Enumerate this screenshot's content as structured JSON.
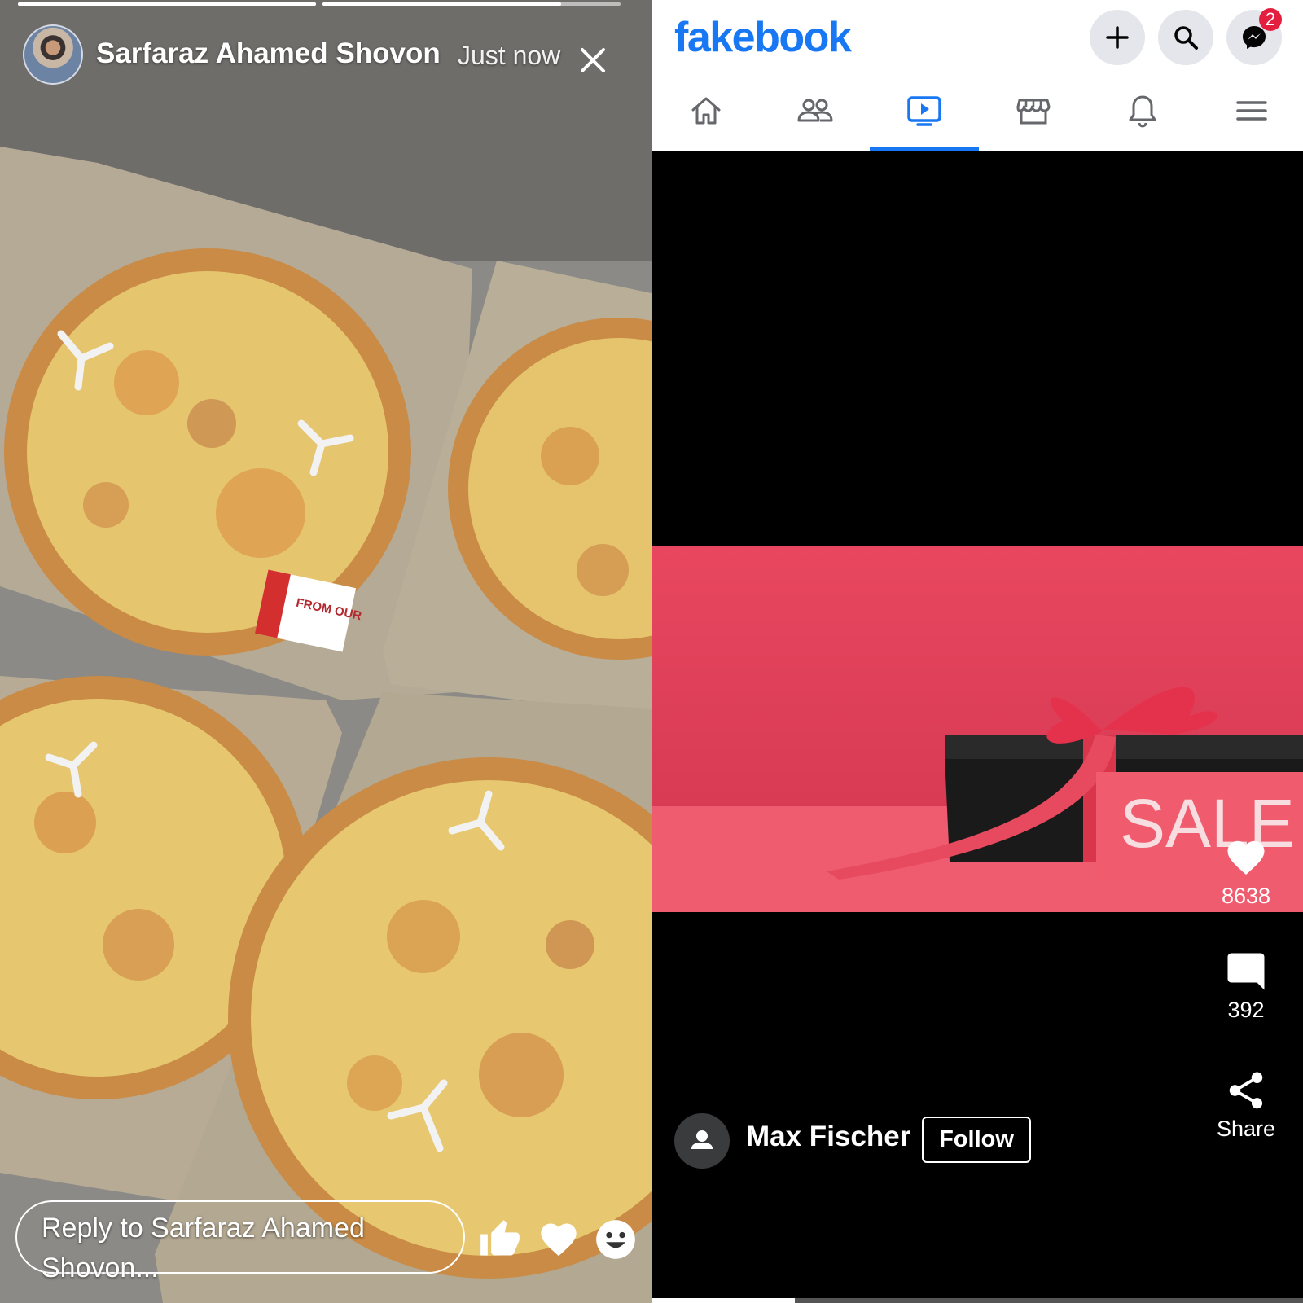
{
  "story": {
    "author_name": "Sarfaraz Ahamed Shovon",
    "timestamp": "Just now",
    "progress": [
      1.0,
      0.8
    ],
    "reply_placeholder": "Reply to Sarfaraz Ahamed Shovon...",
    "box_print": "FROM OUR",
    "reactions": [
      "thumbs-up-icon",
      "heart-icon",
      "smiley-icon"
    ]
  },
  "fb": {
    "logo": "fakebook",
    "messenger_badge": "2",
    "active_tab": "watch",
    "tabs": [
      "home",
      "friends",
      "watch",
      "marketplace",
      "notifications",
      "menu"
    ],
    "video": {
      "sign_text": "SALE",
      "likes": "8638",
      "comments": "392",
      "share_label": "Share",
      "author": "Max Fischer",
      "follow_label": "Follow",
      "playback_progress": 0.22
    },
    "colors": {
      "brand": "#1877f2",
      "badge": "#e41e3f",
      "video_bg": "#e8485e"
    }
  }
}
